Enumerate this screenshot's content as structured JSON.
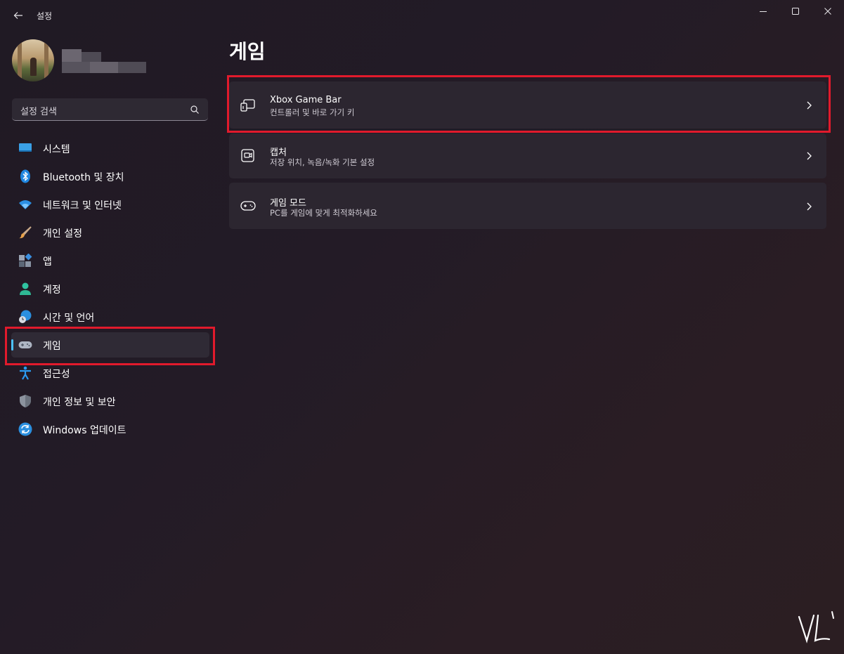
{
  "window": {
    "app_title": "설정",
    "controls": [
      "minimize-icon",
      "maximize-icon",
      "close-icon"
    ]
  },
  "search": {
    "placeholder": "설정 검색"
  },
  "sidebar": {
    "items": [
      {
        "label": "시스템",
        "icon": "system-icon"
      },
      {
        "label": "Bluetooth 및 장치",
        "icon": "bluetooth-icon"
      },
      {
        "label": "네트워크 및 인터넷",
        "icon": "wifi-icon"
      },
      {
        "label": "개인 설정",
        "icon": "brush-icon"
      },
      {
        "label": "앱",
        "icon": "apps-icon"
      },
      {
        "label": "계정",
        "icon": "account-icon"
      },
      {
        "label": "시간 및 언어",
        "icon": "time-language-icon"
      },
      {
        "label": "게임",
        "icon": "gamepad-icon",
        "selected": true
      },
      {
        "label": "접근성",
        "icon": "accessibility-icon"
      },
      {
        "label": "개인 정보 및 보안",
        "icon": "shield-icon"
      },
      {
        "label": "Windows 업데이트",
        "icon": "update-icon"
      }
    ]
  },
  "main": {
    "title": "게임",
    "cards": [
      {
        "title": "Xbox Game Bar",
        "subtitle": "컨트롤러 및 바로 가기 키",
        "icon": "game-bar-icon"
      },
      {
        "title": "캡처",
        "subtitle": "저장 위치, 녹음/녹화 기본 설정",
        "icon": "capture-icon"
      },
      {
        "title": "게임 모드",
        "subtitle": "PC를 게임에 맞게 최적화하세요",
        "icon": "game-mode-icon"
      }
    ]
  },
  "colors": {
    "accent": "#4cc2ff",
    "highlight_box": "#e11a2c",
    "card_bg": "#2c2630"
  }
}
